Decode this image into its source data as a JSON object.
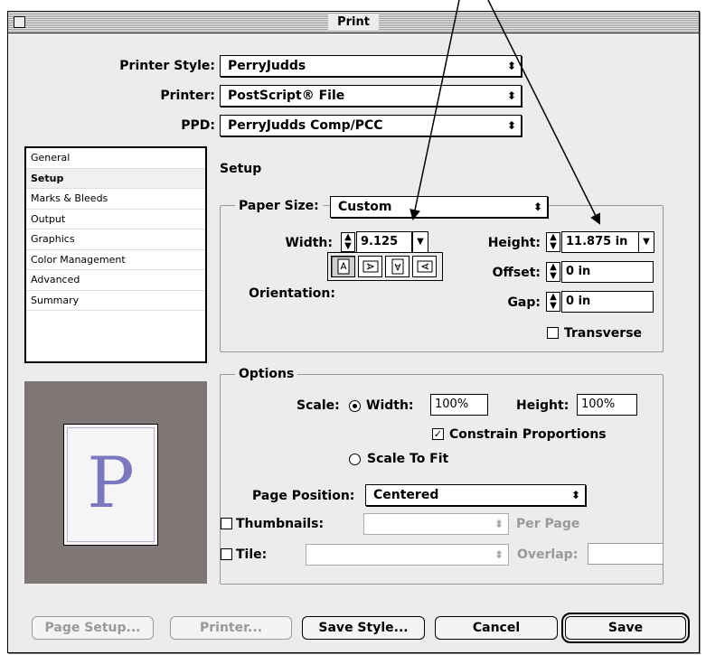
{
  "window": {
    "title": "Print"
  },
  "top_fields": {
    "printer_style": {
      "label": "Printer Style:",
      "value": "PerryJudds"
    },
    "printer": {
      "label": "Printer:",
      "value": "PostScript® File"
    },
    "ppd": {
      "label": "PPD:",
      "value": "PerryJudds Comp/PCC"
    }
  },
  "sidebar": {
    "items": [
      {
        "label": "General"
      },
      {
        "label": "Setup"
      },
      {
        "label": "Marks & Bleeds"
      },
      {
        "label": "Output"
      },
      {
        "label": "Graphics"
      },
      {
        "label": "Color Management"
      },
      {
        "label": "Advanced"
      },
      {
        "label": "Summary"
      }
    ],
    "selected": "Setup"
  },
  "preview": {
    "letter": "P"
  },
  "setup": {
    "heading": "Setup",
    "paper_size_label": "Paper Size:",
    "paper_size_value": "Custom",
    "width_label": "Width:",
    "width_value": "9.125 in",
    "height_label": "Height:",
    "height_value": "11.875 in",
    "offset_label": "Offset:",
    "offset_value": "0 in",
    "gap_label": "Gap:",
    "gap_value": "0 in",
    "orientation_label": "Orientation:",
    "transverse_label": "Transverse",
    "transverse_checked": false
  },
  "options": {
    "heading": "Options",
    "scale_label": "Scale:",
    "scale_width_label": "Width:",
    "scale_width_value": "100%",
    "scale_height_label": "Height:",
    "scale_height_value": "100%",
    "constrain_label": "Constrain Proportions",
    "constrain_checked": true,
    "scale_to_fit_label": "Scale To Fit",
    "page_position_label": "Page Position:",
    "page_position_value": "Centered",
    "thumbnails_label": "Thumbnails:",
    "per_page_label": "Per Page",
    "tile_label": "Tile:",
    "overlap_label": "Overlap:"
  },
  "buttons": {
    "page_setup": "Page Setup...",
    "printer": "Printer...",
    "save_style": "Save Style...",
    "cancel": "Cancel",
    "save": "Save"
  }
}
